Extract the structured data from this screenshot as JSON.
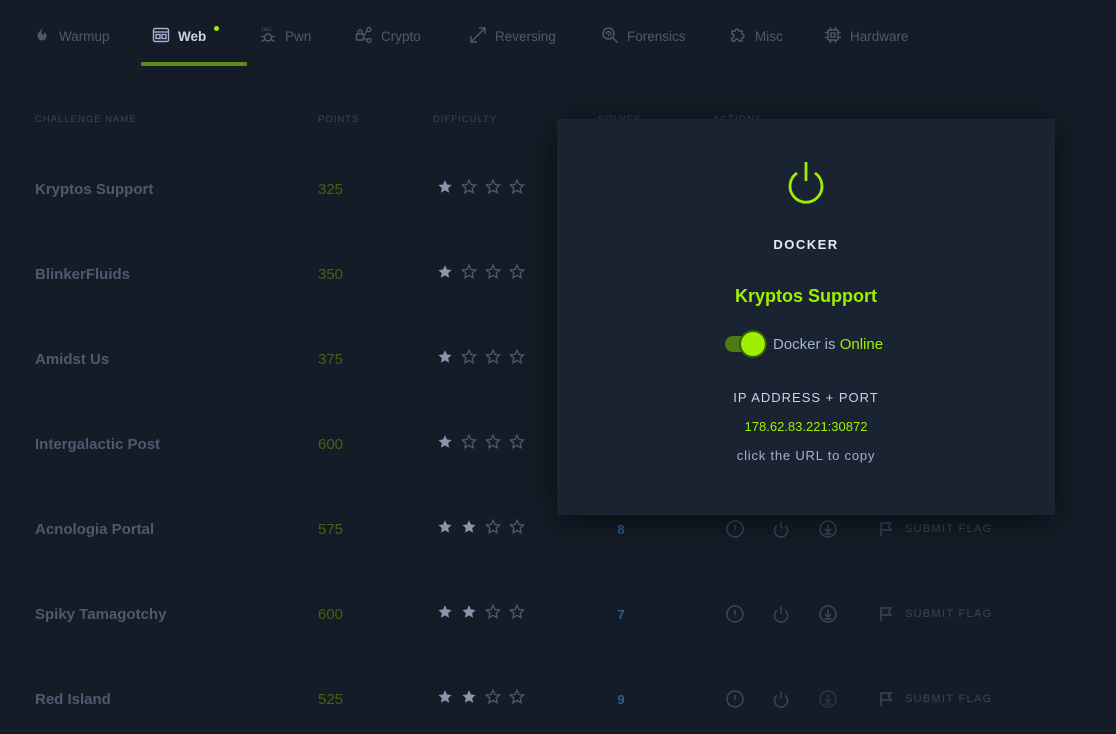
{
  "tabs": [
    {
      "label": "Warmup",
      "icon": "flame-icon"
    },
    {
      "label": "Web",
      "icon": "browser-window-icon"
    },
    {
      "label": "Pwn",
      "icon": "binary-bug-icon"
    },
    {
      "label": "Crypto",
      "icon": "lock-network-icon"
    },
    {
      "label": "Reversing",
      "icon": "diagonal-arrows-icon"
    },
    {
      "label": "Forensics",
      "icon": "magnifier-fingerprint-icon"
    },
    {
      "label": "Misc",
      "icon": "puzzle-icon"
    },
    {
      "label": "Hardware",
      "icon": "chip-icon"
    }
  ],
  "active_tab": "Web",
  "columns": {
    "name": "CHALLENGE NAME",
    "points": "POINTS",
    "difficulty": "DIFFICULTY",
    "solves": "SOLVES",
    "actions": "ACTIONS"
  },
  "challenges": [
    {
      "name": "Kryptos Support",
      "points": "325",
      "stars": 1,
      "solves": ""
    },
    {
      "name": "BlinkerFluids",
      "points": "350",
      "stars": 1,
      "solves": ""
    },
    {
      "name": "Amidst Us",
      "points": "375",
      "stars": 1,
      "solves": ""
    },
    {
      "name": "Intergalactic Post",
      "points": "600",
      "stars": 1,
      "solves": ""
    },
    {
      "name": "Acnologia Portal",
      "points": "575",
      "stars": 2,
      "solves": "8"
    },
    {
      "name": "Spiky Tamagotchy",
      "points": "600",
      "stars": 2,
      "solves": "7"
    },
    {
      "name": "Red Island",
      "points": "525",
      "stars": 2,
      "solves": "9"
    }
  ],
  "submit_flag_label": "SUBMIT FLAG",
  "stars_total": 4,
  "colors": {
    "accent": "#9fef00",
    "background": "#141c27",
    "modal": "#1a2332",
    "star_filled": "#8795ad",
    "star_empty": "#4c5a70",
    "solves": "#2d5e8a"
  },
  "modal": {
    "icon": "power-icon",
    "title": "DOCKER",
    "challenge": "Kryptos Support",
    "status_prefix": "Docker is ",
    "status": "Online",
    "ip_label": "IP ADDRESS + PORT",
    "ip": "178.62.83.221:30872",
    "hint": "click the URL to copy"
  }
}
